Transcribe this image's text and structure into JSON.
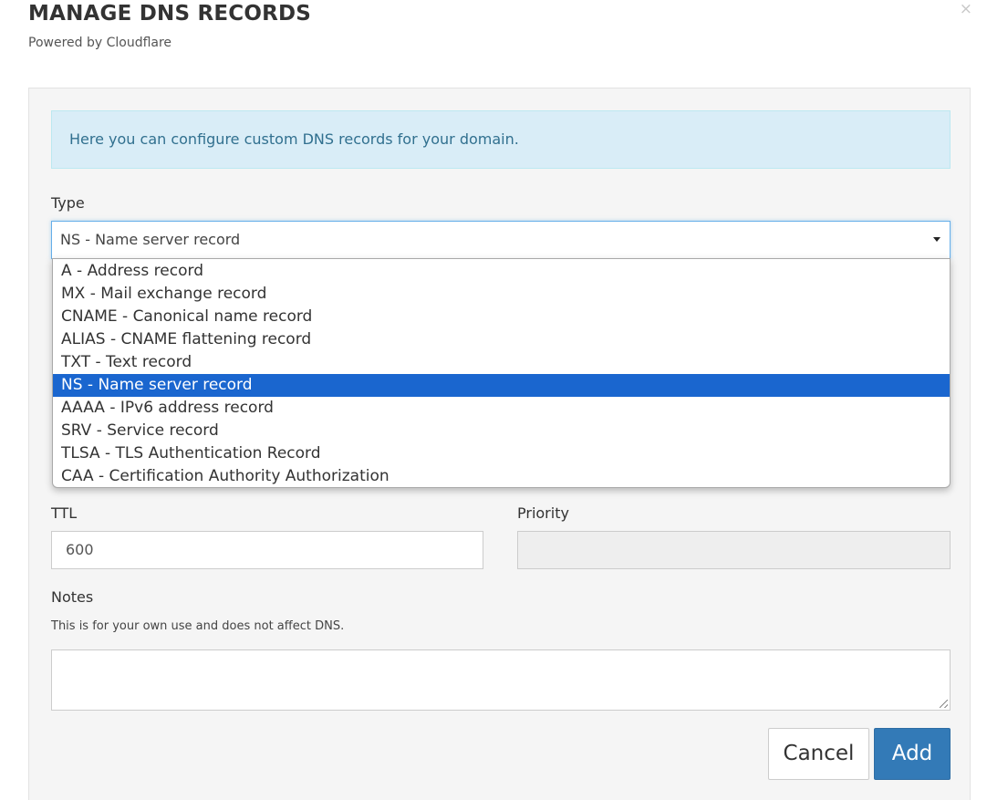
{
  "dialog": {
    "title": "MANAGE DNS RECORDS",
    "subtitle": "Powered by Cloudflare",
    "close_icon": "×"
  },
  "info_text": "Here you can configure custom DNS records for your domain.",
  "type": {
    "label": "Type",
    "selected": "NS - Name server record",
    "options": [
      "A - Address record",
      "MX - Mail exchange record",
      "CNAME - Canonical name record",
      "ALIAS - CNAME flattening record",
      "TXT - Text record",
      "NS - Name server record",
      "AAAA - IPv6 address record",
      "SRV - Service record",
      "TLSA - TLS Authentication Record",
      "CAA - Certification Authority Authorization"
    ]
  },
  "ttl": {
    "label": "TTL",
    "value": "600"
  },
  "priority": {
    "label": "Priority",
    "value": ""
  },
  "notes": {
    "label": "Notes",
    "hint": "This is for your own use and does not affect DNS.",
    "value": ""
  },
  "buttons": {
    "cancel": "Cancel",
    "add": "Add"
  },
  "colors": {
    "selected_option": "#1a66cf",
    "primary_button": "#337ab7",
    "info_background": "#d9edf7",
    "info_text": "#31708f"
  }
}
